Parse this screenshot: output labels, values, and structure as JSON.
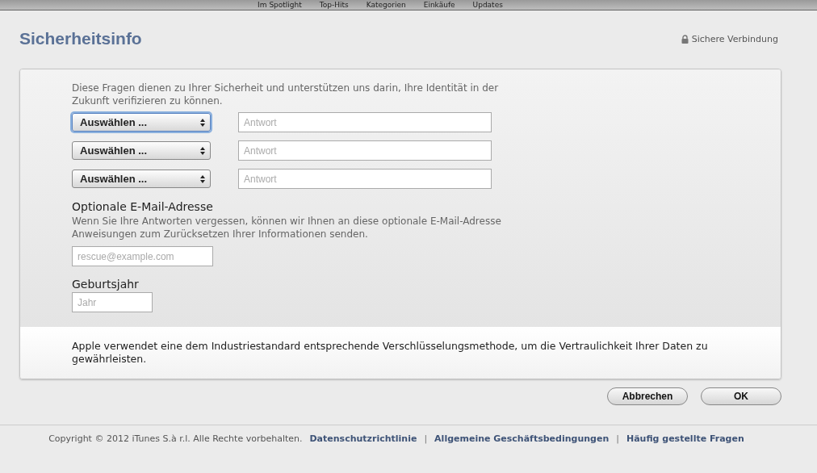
{
  "top_nav": [
    {
      "label": "Im Spotlight"
    },
    {
      "label": "Top-Hits"
    },
    {
      "label": "Kategorien"
    },
    {
      "label": "Einkäufe"
    },
    {
      "label": "Updates"
    }
  ],
  "page": {
    "title": "Sicherheitsinfo",
    "secure_label": "Sichere Verbindung"
  },
  "intro": "Diese Fragen dienen zu Ihrer Sicherheit und unterstützen uns darin, Ihre Identität in der Zukunft verifizieren zu können.",
  "questions": [
    {
      "select": "Auswählen ...",
      "focused": true,
      "placeholder": "Antwort"
    },
    {
      "select": "Auswählen ...",
      "focused": false,
      "placeholder": "Antwort"
    },
    {
      "select": "Auswählen ...",
      "focused": false,
      "placeholder": "Antwort"
    }
  ],
  "email": {
    "heading": "Optionale E-Mail-Adresse",
    "description": "Wenn Sie Ihre Antworten vergessen, können wir Ihnen an diese optionale E-Mail-Adresse Anweisungen zum Zurücksetzen Ihrer Informationen senden.",
    "placeholder": "rescue@example.com"
  },
  "birth_year": {
    "heading": "Geburtsjahr",
    "placeholder": "Jahr"
  },
  "encryption_note": "Apple verwendet eine dem Industriestandard entsprechende Verschlüsselungsmethode, um die Vertraulichkeit Ihrer Daten zu gewährleisten.",
  "buttons": [
    {
      "label": "Abbrechen"
    },
    {
      "label": "OK"
    }
  ],
  "footer": {
    "copyright": "Copyright © 2012 iTunes S.à r.l. Alle Rechte vorbehalten.",
    "links": [
      "Datenschutzrichtlinie",
      "Allgemeine Geschäftsbedingungen",
      "Häufig gestellte Fragen"
    ],
    "separator": "|"
  }
}
